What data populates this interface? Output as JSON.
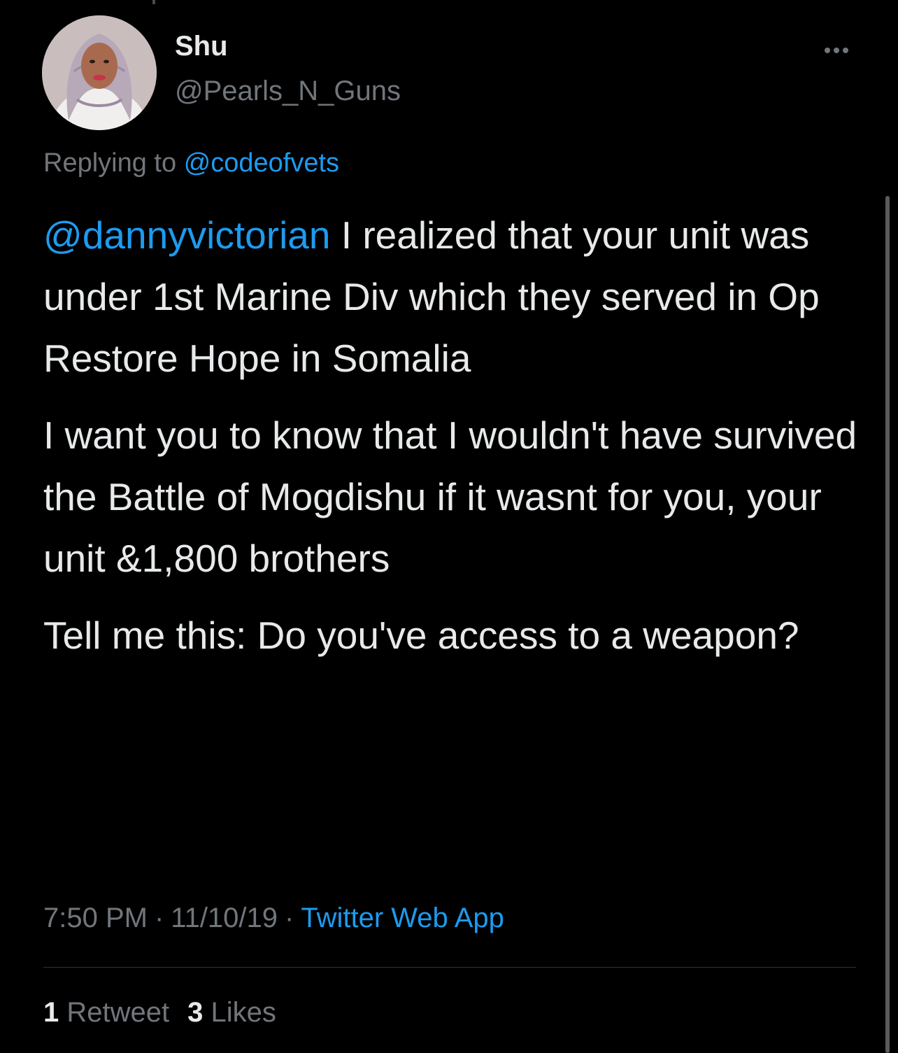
{
  "author": {
    "display_name": "Shu",
    "handle": "@Pearls_N_Guns"
  },
  "reply": {
    "prefix": "Replying to",
    "target": "@codeofvets"
  },
  "tweet": {
    "mention": "@dannyvictorian",
    "para1_text": " I realized that your unit was under 1st Marine Div which they served in Op Restore Hope in Somalia",
    "para2_text": "I want you to know that I wouldn't have survived the Battle of Mogdishu if it wasnt for you, your unit &1,800 brothers",
    "para3_text": "Tell me this:  Do you've access to a weapon?"
  },
  "meta": {
    "time": "7:50 PM",
    "separator": "·",
    "date": "11/10/19",
    "source": "Twitter Web App"
  },
  "stats": {
    "retweets_count": "1",
    "retweets_label": "Retweet",
    "likes_count": "3",
    "likes_label": "Likes"
  },
  "icons": {
    "more": "more-horizontal-icon"
  },
  "colors": {
    "background": "#000000",
    "text_primary": "#e7e9ea",
    "text_secondary": "#71767b",
    "link": "#1d9bf0",
    "divider": "#2f3336"
  }
}
